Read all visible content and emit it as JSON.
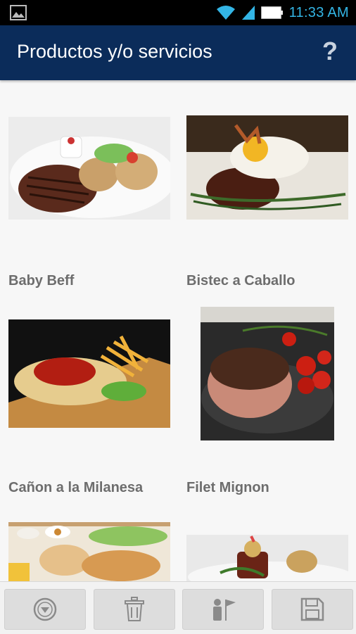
{
  "status_bar": {
    "time": "11:33 AM",
    "icons": [
      "image-notification-icon",
      "wifi-icon",
      "signal-icon",
      "battery-icon"
    ]
  },
  "app_bar": {
    "title": "Productos y/o servicios",
    "help_label": "?"
  },
  "products": [
    {
      "name": "Baby Beff",
      "image": "grilled steak with baked potatoes"
    },
    {
      "name": "Bistec a Caballo",
      "image": "steak topped with fried egg"
    },
    {
      "name": "Cañon a la Milanesa",
      "image": "breaded cutlet with tomato sauce and fries"
    },
    {
      "name": "Filet Mignon",
      "image": "bacon-wrapped filet with cherry tomatoes"
    },
    {
      "name": "",
      "image": "platter with breaded meat and salad"
    },
    {
      "name": "",
      "image": "steak tower with pasta"
    }
  ],
  "bottom_bar": {
    "buttons": [
      "filter-icon",
      "trash-icon",
      "person-flag-icon",
      "save-icon"
    ]
  },
  "colors": {
    "app_bar": "#0b2c5a",
    "status_accent": "#33b5e5",
    "label_text": "#6d6d6d",
    "background": "#f7f7f7"
  }
}
